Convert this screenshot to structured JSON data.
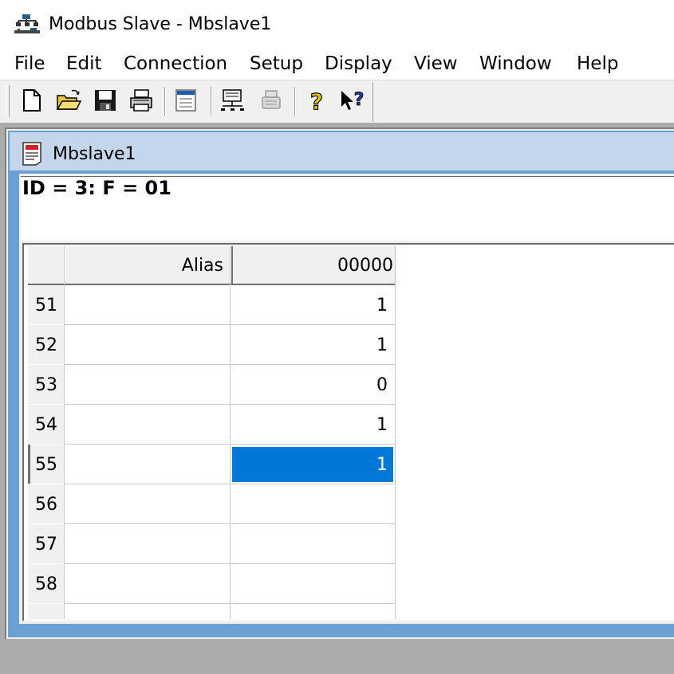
{
  "window": {
    "title": "Modbus Slave - Mbslave1",
    "icon": "modbus-network-icon"
  },
  "menu": [
    "File",
    "Edit",
    "Connection",
    "Setup",
    "Display",
    "View",
    "Window",
    "Help"
  ],
  "toolbar": {
    "buttons": [
      "new-document-icon",
      "open-folder-icon",
      "save-disk-icon",
      "print-icon",
      "window-icon",
      "connect-icon",
      "disconnect-icon",
      "help-icon",
      "context-help-icon"
    ]
  },
  "child": {
    "title": "Mbslave1",
    "icon": "doc-icon",
    "info": "ID = 3: F = 01"
  },
  "grid": {
    "headers": {
      "alias": "Alias",
      "address": "00000"
    },
    "rows": [
      {
        "num": "51",
        "alias": "",
        "value": "1"
      },
      {
        "num": "52",
        "alias": "",
        "value": "1"
      },
      {
        "num": "53",
        "alias": "",
        "value": "0"
      },
      {
        "num": "54",
        "alias": "",
        "value": "1"
      },
      {
        "num": "55",
        "alias": "",
        "value": "1"
      },
      {
        "num": "56",
        "alias": "",
        "value": ""
      },
      {
        "num": "57",
        "alias": "",
        "value": ""
      },
      {
        "num": "58",
        "alias": "",
        "value": ""
      }
    ],
    "selected_row": "55"
  },
  "colors": {
    "selection": "#0078d7",
    "caption": "#c4d6e9",
    "mdi_background": "#ababab"
  }
}
